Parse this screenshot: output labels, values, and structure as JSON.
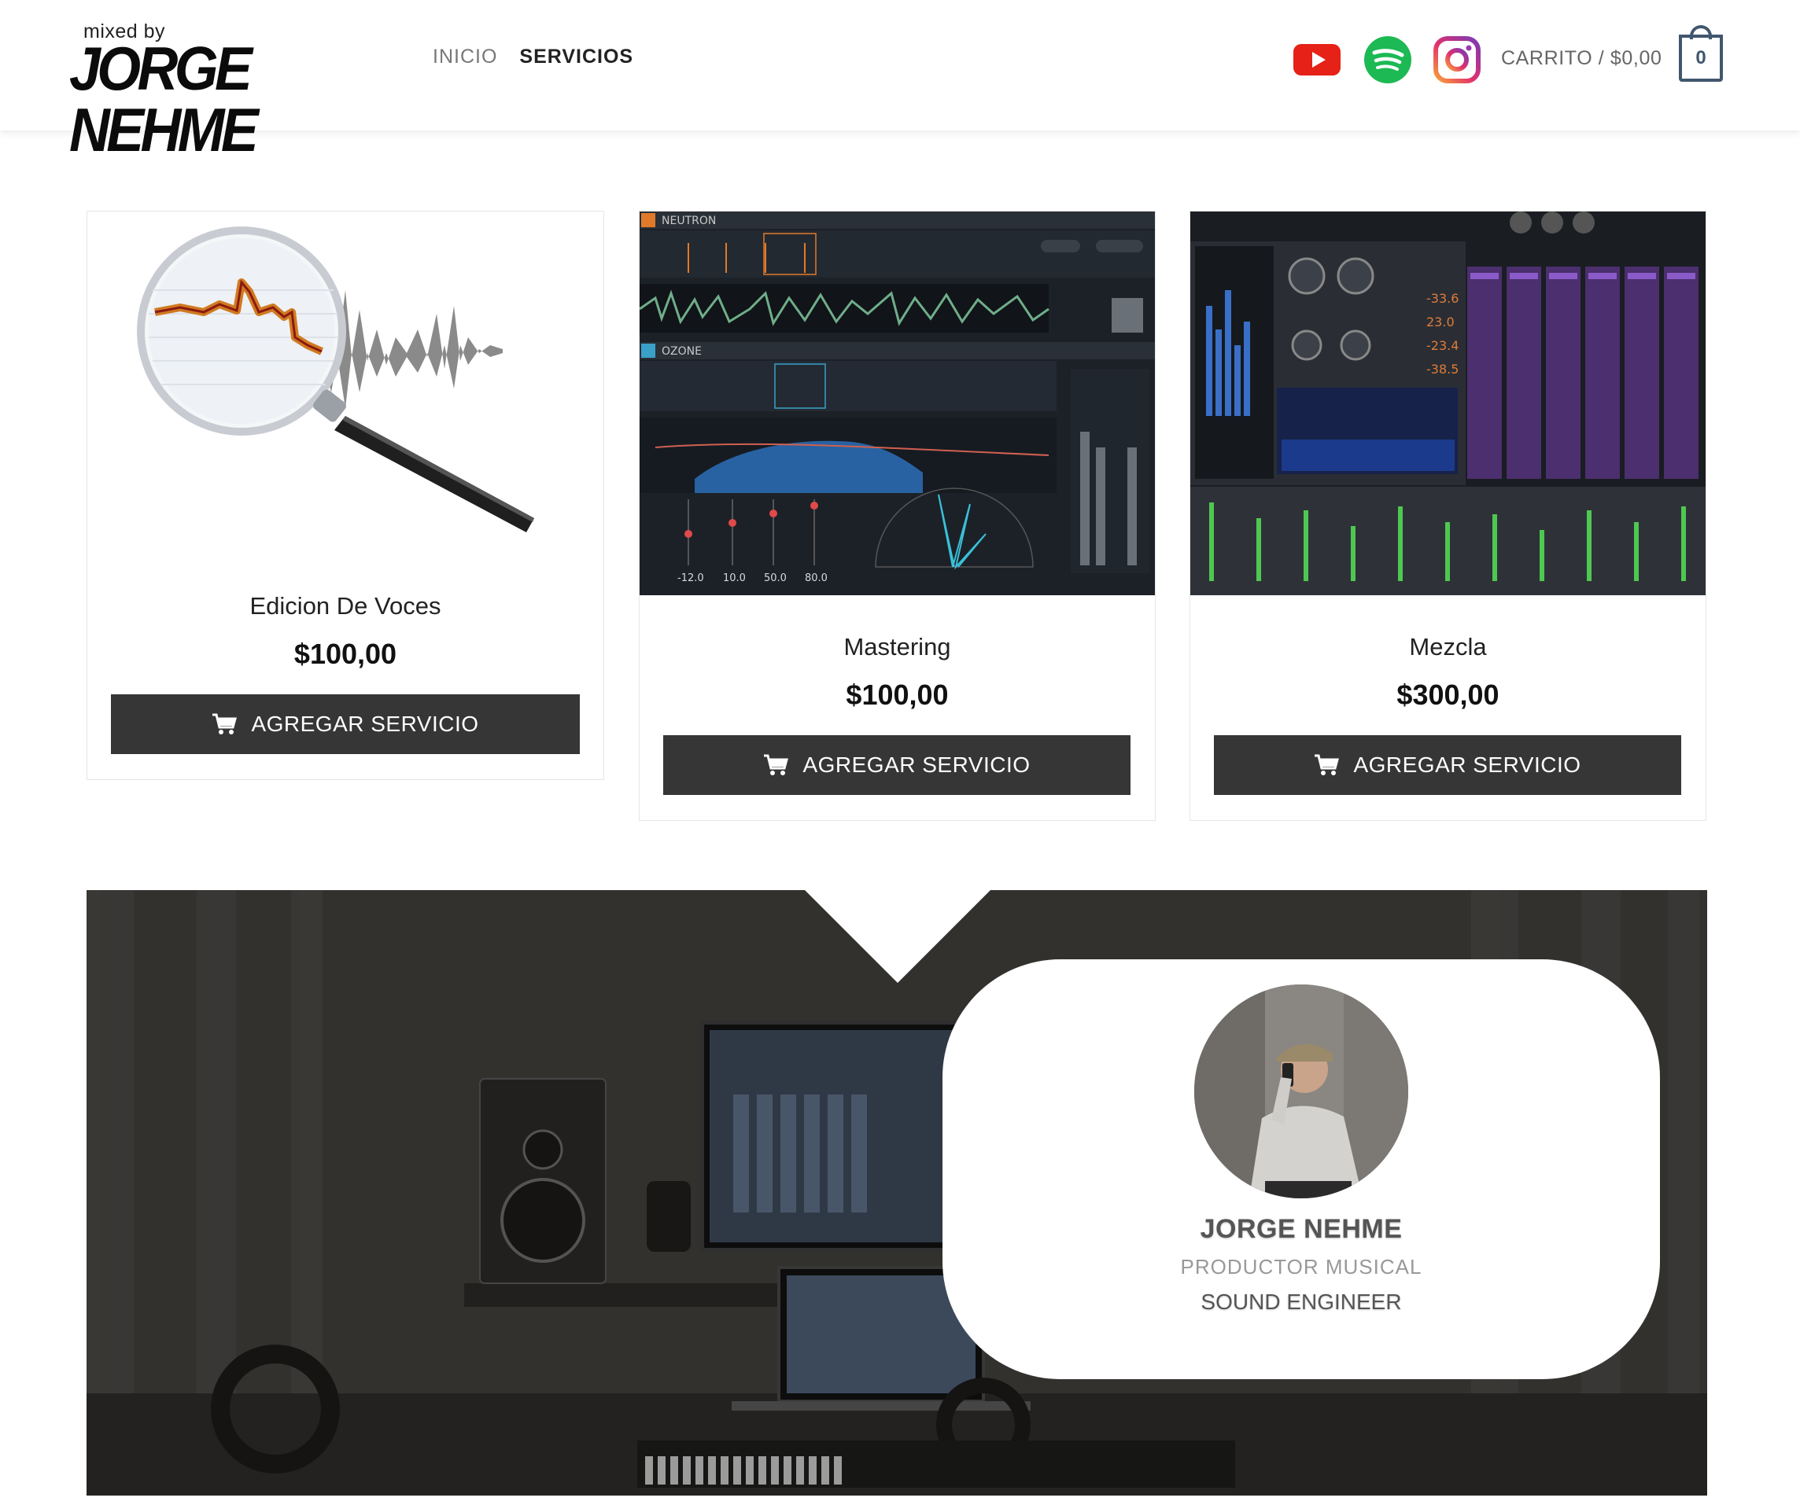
{
  "brand": {
    "small": "mixed by",
    "big": "JORGE NEHME"
  },
  "nav": {
    "items": [
      {
        "label": "INICIO"
      },
      {
        "label": "SERVICIOS"
      }
    ]
  },
  "social": {
    "youtube": "youtube-icon",
    "spotify": "spotify-icon",
    "instagram": "instagram-icon"
  },
  "cart": {
    "label": "CARRITO / $0,00",
    "count": "0"
  },
  "products": [
    {
      "title": "Edicion De Voces",
      "price": "$100,00",
      "button": "AGREGAR SERVICIO"
    },
    {
      "title": "Mastering",
      "price": "$100,00",
      "button": "AGREGAR SERVICIO"
    },
    {
      "title": "Mezcla",
      "price": "$300,00",
      "button": "AGREGAR SERVICIO"
    }
  ],
  "profile": {
    "name": "JORGE NEHME",
    "role": "PRODUCTOR MUSICAL",
    "role2": "SOUND ENGINEER"
  },
  "colors": {
    "button_bg": "#363636",
    "cart_accent": "#40576e",
    "youtube": "#e62117",
    "spotify": "#1db954"
  }
}
